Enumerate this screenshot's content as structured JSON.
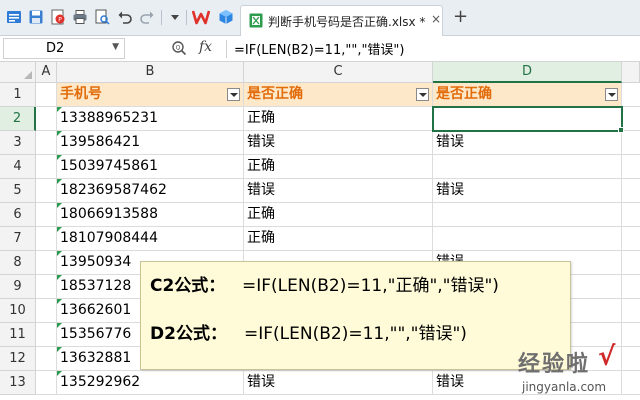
{
  "document": {
    "tab_title": "判断手机号码是否正确.xlsx *",
    "tab_close": "×",
    "new_tab": "+"
  },
  "quick_access": {
    "icons": [
      "app-menu-icon",
      "save-icon",
      "export-pdf-icon",
      "print-icon",
      "print-preview-icon",
      "undo-icon",
      "redo-icon",
      "customize-arrow-icon",
      "wps-logo-icon",
      "cloud-cube-icon"
    ]
  },
  "formula_bar": {
    "name_box": "D2",
    "fx_label": "fx",
    "formula": "=IF(LEN(B2)=11,\"\",\"错误\")"
  },
  "columns": [
    "A",
    "B",
    "C",
    "D"
  ],
  "active_column": "D",
  "rows": [
    "1",
    "2",
    "3",
    "4",
    "5",
    "6",
    "7",
    "8",
    "9",
    "10",
    "11",
    "12",
    "13"
  ],
  "active_row": "2",
  "table": {
    "headers": [
      "手机号",
      "是否正确",
      "是否正确"
    ],
    "phones": [
      "13388965231",
      "139586421",
      "15039745861",
      "182369587462",
      "18066913588",
      "18107908444",
      "13950934",
      "18537128",
      "13662601",
      "15356776",
      "13632881",
      "135292962"
    ],
    "status_c": [
      "正确",
      "错误",
      "正确",
      "错误",
      "正确",
      "正确",
      "",
      "",
      "",
      "",
      "",
      "错误"
    ],
    "status_d": [
      "",
      "错误",
      "",
      "错误",
      "",
      "",
      "错误",
      "",
      "",
      "",
      "",
      "错误"
    ]
  },
  "note": {
    "line1_label": "C2公式：",
    "line1_formula": "=IF(LEN(B2)=11,\"正确\",\"错误\")",
    "line2_label": "D2公式：",
    "line2_formula": "=IF(LEN(B2)=11,\"\",\"错误\")"
  },
  "watermark": {
    "main": "经验啦",
    "check": "√",
    "url": "jingyanla.com"
  },
  "colors": {
    "header_fill": "#fde9c9",
    "header_text": "#e26b0a",
    "selection": "#217346",
    "note_fill": "#fffbd8"
  }
}
